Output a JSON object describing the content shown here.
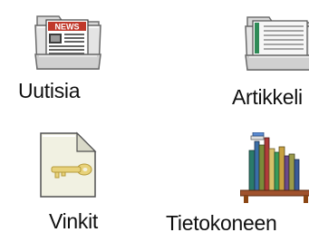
{
  "window": {
    "background": "#ffffff"
  },
  "icons": [
    {
      "label": "Uutisia",
      "icon": "news-folder-icon"
    },
    {
      "label": "Artikkeli",
      "icon": "articles-folder-icon"
    },
    {
      "label": "Vinkit",
      "icon": "tip-document-icon"
    },
    {
      "label": "Tietokoneen",
      "icon": "bookshelf-icon"
    }
  ],
  "news_folder": {
    "badge_text": "NEWS"
  },
  "colors": {
    "folder_fill": "#dcdcdc",
    "folder_shadow": "#808080",
    "news_badge": "#c0392b",
    "document_fill": "#f2f2e4",
    "key_yellow": "#e8d27a",
    "label_text": "#101010"
  }
}
